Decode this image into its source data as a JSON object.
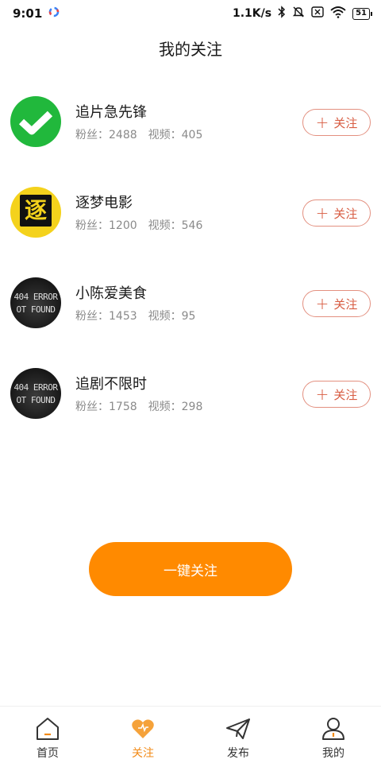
{
  "status_bar": {
    "time": "9:01",
    "network_speed": "1.1K/s",
    "battery": "51"
  },
  "page": {
    "title": "我的关注"
  },
  "follow_list": [
    {
      "name": "追片急先锋",
      "fans": "粉丝：2488",
      "videos": "视频：405",
      "avatar": "green-check",
      "button": "关注"
    },
    {
      "name": "逐梦电影",
      "fans": "粉丝：1200",
      "videos": "视频：546",
      "avatar": "yellow-logo",
      "button": "关注",
      "avatar_text": "逐"
    },
    {
      "name": "小陈爱美食",
      "fans": "粉丝：1453",
      "videos": "视频：95",
      "avatar": "not-found",
      "button": "关注",
      "avatar_text_1": "404 ERROR",
      "avatar_text_2": "OT FOUND"
    },
    {
      "name": "追剧不限时",
      "fans": "粉丝：1758",
      "videos": "视频：298",
      "avatar": "not-found",
      "button": "关注",
      "avatar_text_1": "404 ERROR",
      "avatar_text_2": "OT FOUND"
    }
  ],
  "follow_all_button": "一键关注",
  "bottom_nav": [
    {
      "label": "首页",
      "icon": "home-icon",
      "active": false
    },
    {
      "label": "关注",
      "icon": "heart-icon",
      "active": true
    },
    {
      "label": "发布",
      "icon": "send-icon",
      "active": false
    },
    {
      "label": "我的",
      "icon": "profile-icon",
      "active": false
    }
  ],
  "colors": {
    "accent": "#ff8a00",
    "follow_button_text": "#d85d43",
    "follow_button_border": "#e39080"
  }
}
